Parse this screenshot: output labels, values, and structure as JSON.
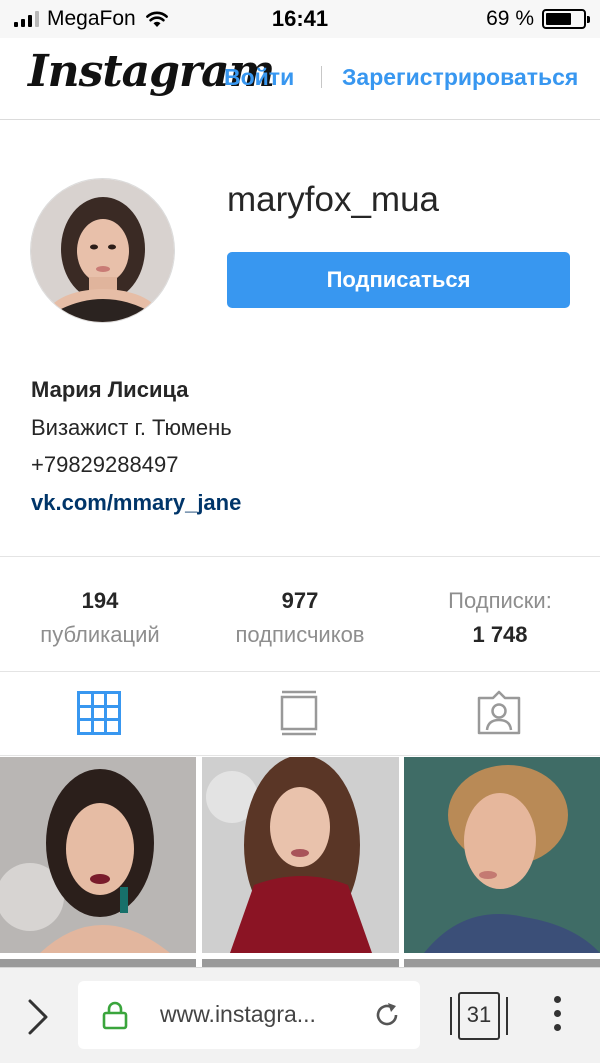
{
  "status_bar": {
    "carrier": "MegaFon",
    "time": "16:41",
    "battery": "69 %",
    "battery_level": 0.69
  },
  "header": {
    "logo": "Instagram",
    "login": "Войти",
    "signup": "Зарегистрироваться"
  },
  "profile": {
    "username": "maryfox_mua",
    "follow_button": "Подписаться",
    "full_name": "Мария Лисица",
    "bio": "Визажист г. Тюмень",
    "phone": "+79829288497",
    "link": "vk.com/mmary_jane"
  },
  "stats": {
    "posts_count": "194",
    "posts_label": "публикаций",
    "followers_count": "977",
    "followers_label": "подписчиков",
    "following_label": "Подписки:",
    "following_count": "1 748"
  },
  "tabs": {
    "active": "grid",
    "grid_icon": "grid-icon",
    "feed_icon": "feed-icon",
    "tagged_icon": "tagged-icon"
  },
  "colors": {
    "accent": "#3897f0",
    "link": "#003569"
  },
  "browser": {
    "url": "www.instagra...",
    "tab_count": "31"
  }
}
